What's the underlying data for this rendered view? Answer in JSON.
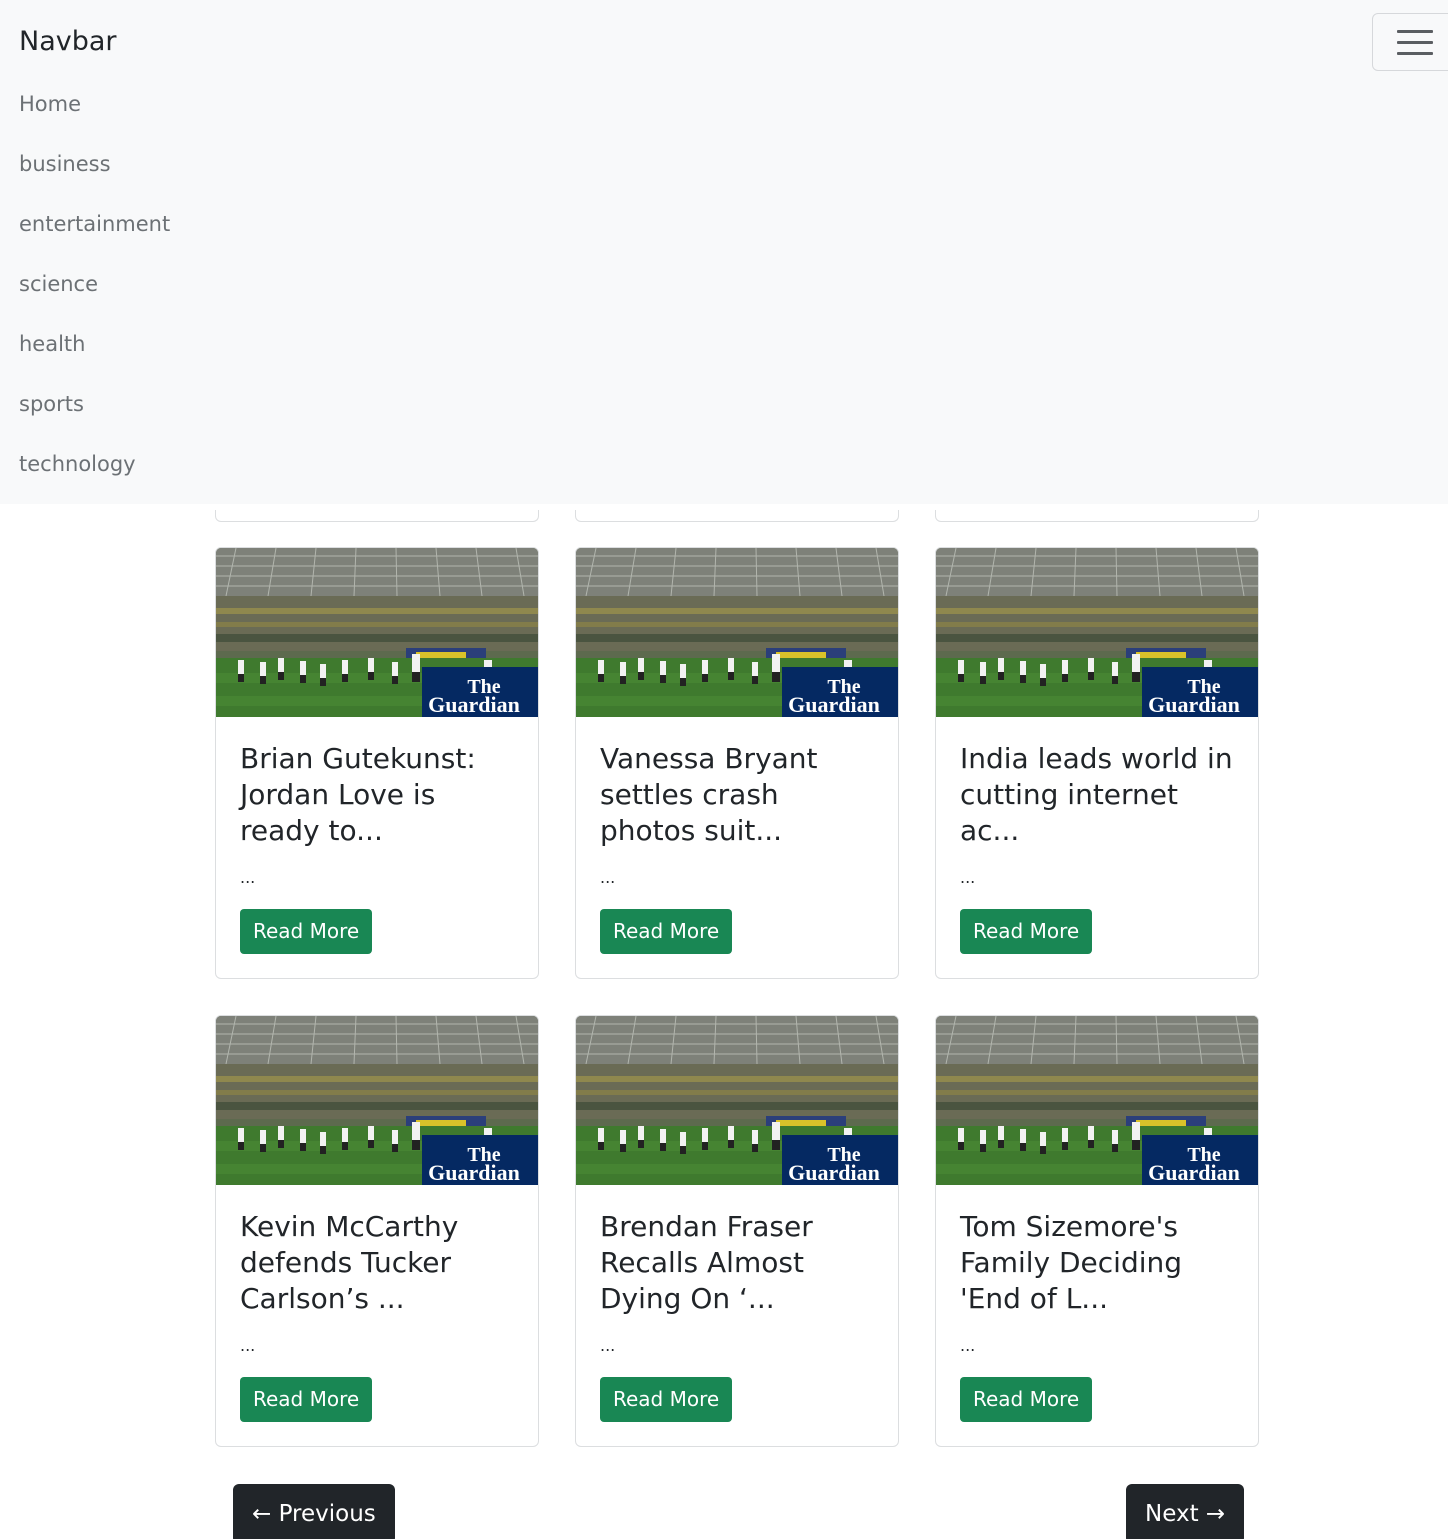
{
  "navbar": {
    "brand": "Navbar",
    "links": [
      "Home",
      "business",
      "entertainment",
      "science",
      "health",
      "sports",
      "technology"
    ]
  },
  "image_logo": {
    "line1": "The",
    "line2": "Guardian"
  },
  "cards": [
    {
      "title": "Brian Gutekunst: Jordan Love is ready to...",
      "text": "...",
      "button": "Read More"
    },
    {
      "title": "Vanessa Bryant settles crash photos suit...",
      "text": "...",
      "button": "Read More"
    },
    {
      "title": "India leads world in cutting internet ac...",
      "text": "...",
      "button": "Read More"
    },
    {
      "title": "Kevin McCarthy defends Tucker Carlson’s ...",
      "text": "...",
      "button": "Read More"
    },
    {
      "title": "Brendan Fraser Recalls Almost Dying On ‘...",
      "text": "...",
      "button": "Read More"
    },
    {
      "title": "Tom Sizemore's Family Deciding 'End of L...",
      "text": "...",
      "button": "Read More"
    }
  ],
  "pagination": {
    "previous": "← Previous",
    "next": "Next →"
  },
  "colors": {
    "button_green": "#198754",
    "pagination_dark": "#212529",
    "logo_blue": "#052962",
    "navbar_bg": "#f8f9fa"
  }
}
